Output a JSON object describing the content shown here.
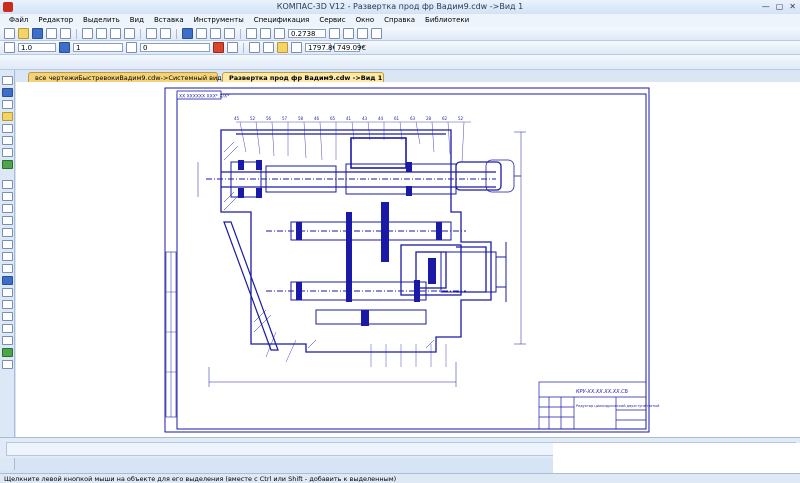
{
  "window": {
    "title": "КОМПАС-3D V12 - Развертка прод фр Вадим9.cdw ->Вид 1"
  },
  "menu": [
    "Файл",
    "Редактор",
    "Выделить",
    "Вид",
    "Вставка",
    "Инструменты",
    "Спецификация",
    "Сервис",
    "Окно",
    "Справка",
    "Библиотеки"
  ],
  "toolbar": {
    "zoom_value": "0.2738",
    "line_width": "1.0",
    "layer": "1",
    "style": "0",
    "coord_x": "1797.8€",
    "coord_y": "749.09€"
  },
  "tabs": [
    {
      "label": "все чертежиБыстревокиВадим9.cdw->Системный вид"
    },
    {
      "label": "Развертка прод фр Вадим9.cdw ->Вид 1"
    }
  ],
  "drawing": {
    "stamp_top": "ХХ ХХХХХХ ХХХ* Х/Х*",
    "doc_code": "КРУ-ХХ.ХХ.ХХ.ХХ.СБ",
    "doc_title": "Редуктор цилиндрический двухступенчатый"
  },
  "status": {
    "hint": "Щелкните левой кнопкой мыши на объекте для его выделения (вместе с Ctrl или Shift - добавить к выделенным)"
  },
  "colors": {
    "drawing_line": "#1a1aa6",
    "tab_active": "#ffe9a8",
    "accent": "#cc2a1a"
  }
}
